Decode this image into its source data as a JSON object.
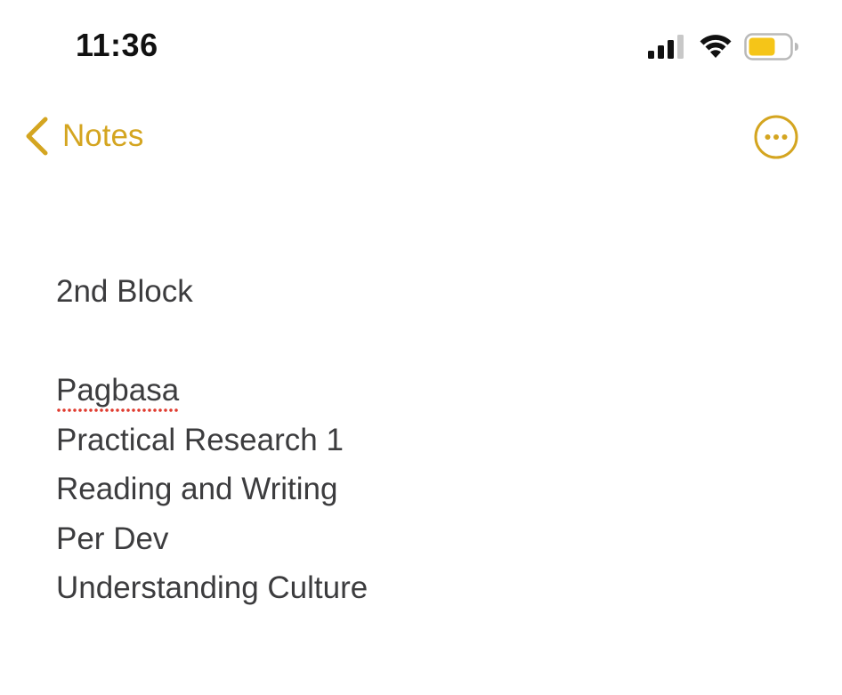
{
  "status_bar": {
    "time": "11:36",
    "icons": [
      "cellular-signal-icon",
      "wifi-icon",
      "battery-icon"
    ],
    "battery_color": "#f5c518"
  },
  "nav": {
    "back_label": "Notes",
    "back_icon": "chevron-left-icon",
    "more_icon": "ellipsis-circle-icon",
    "accent_color": "#d4a520"
  },
  "note": {
    "title": "2nd Block",
    "lines": [
      "Pagbasa",
      "Practical Research 1",
      "Reading and Writing",
      "Per Dev",
      "Understanding Culture"
    ],
    "misspelled_words": [
      "Pagbasa"
    ],
    "spellcheck_underline_color": "#e03b2f"
  }
}
